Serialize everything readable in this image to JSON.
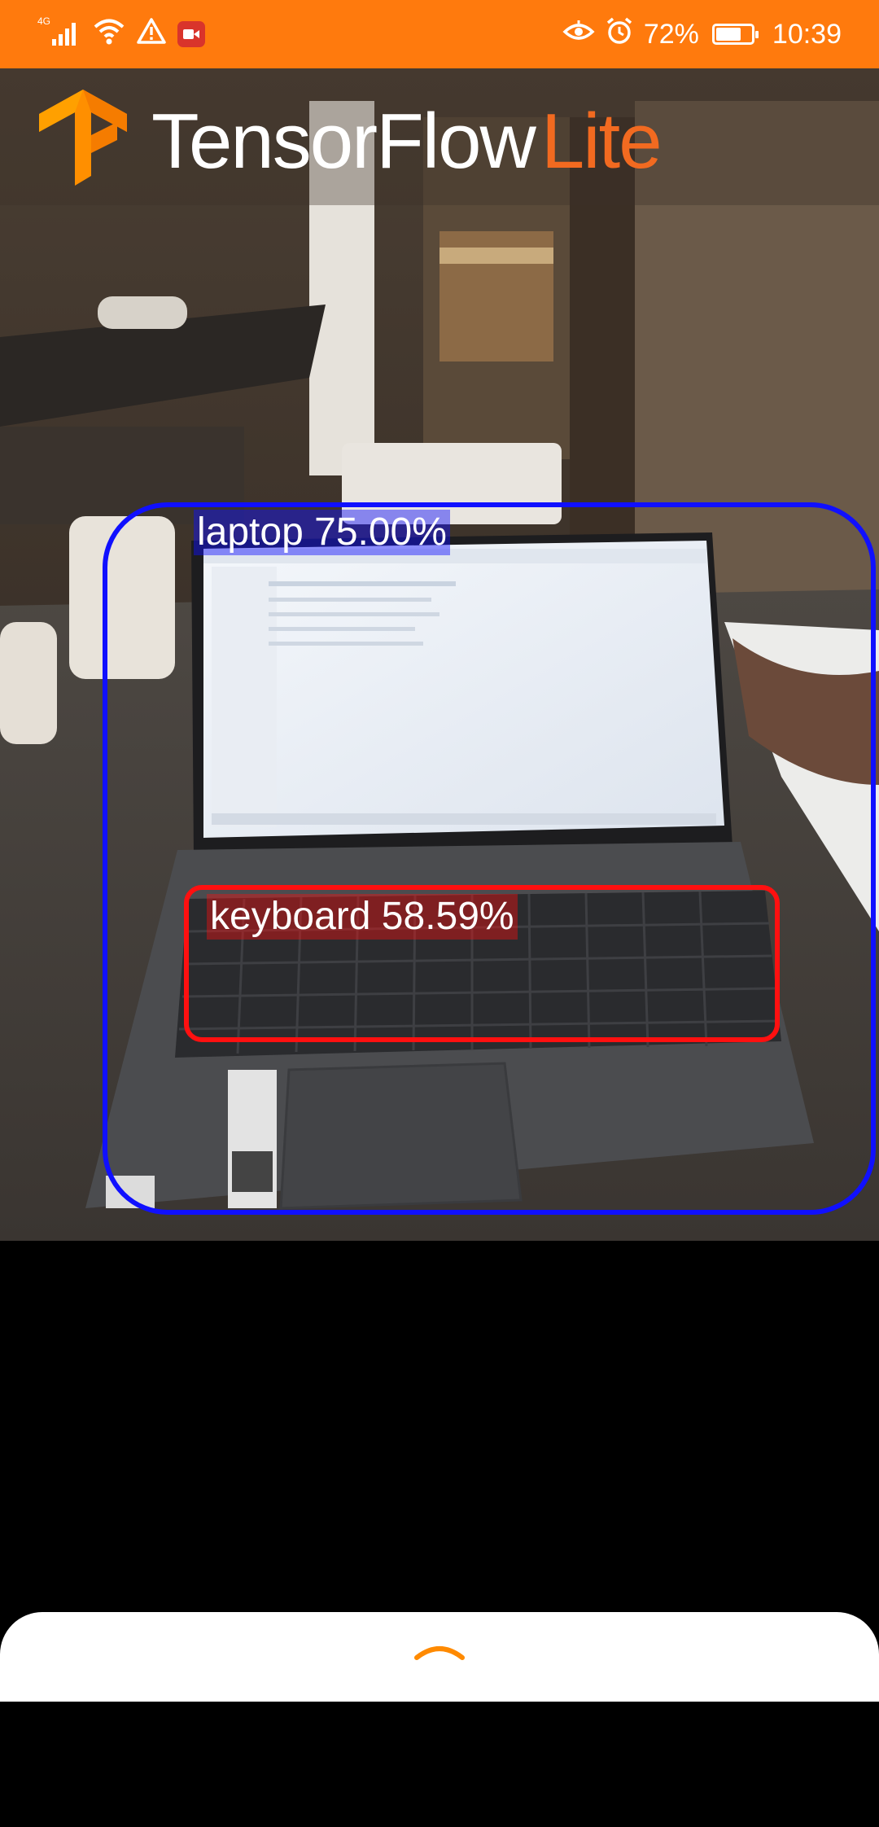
{
  "status_bar": {
    "network": "4G",
    "battery_percent": "72%",
    "battery_level": 0.72,
    "time": "10:39",
    "icons": [
      "signal-icon",
      "wifi-icon",
      "warning-icon",
      "screen-record-icon",
      "eye-comfort-icon",
      "alarm-icon",
      "battery-icon"
    ]
  },
  "app_header": {
    "logo": "tensorflow-logo",
    "brand_main": "TensorFlow",
    "brand_accent": "Lite",
    "accent_color": "#f26a20"
  },
  "detections": [
    {
      "label": "laptop",
      "score": "75.00%",
      "text": "laptop 75.00%",
      "color": "#1010ff"
    },
    {
      "label": "keyboard",
      "score": "58.59%",
      "text": "keyboard 58.59%",
      "color": "#ff1010"
    }
  ],
  "bottom_sheet": {
    "toggle_icon": "chevron-up-icon",
    "icon_color": "#ff8a00"
  },
  "colors": {
    "status_bar": "#ff7a0d"
  }
}
